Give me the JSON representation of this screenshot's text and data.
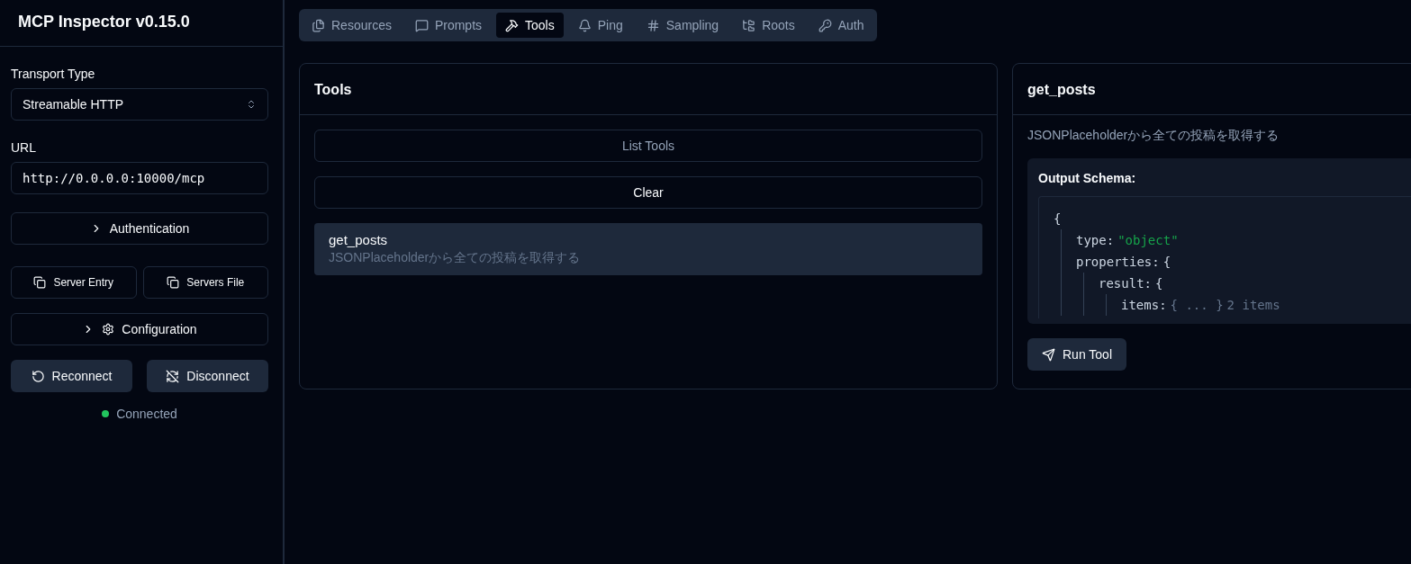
{
  "sidebar": {
    "title": "MCP Inspector v0.15.0",
    "transport": {
      "label": "Transport Type",
      "value": "Streamable HTTP"
    },
    "url": {
      "label": "URL",
      "value": "http://0.0.0.0:10000/mcp"
    },
    "authentication": {
      "label": "Authentication",
      "expanded": false
    },
    "server_entry": {
      "label": "Server Entry"
    },
    "servers_file": {
      "label": "Servers File"
    },
    "configuration": {
      "label": "Configuration",
      "expanded": false
    },
    "reconnect": {
      "label": "Reconnect"
    },
    "disconnect": {
      "label": "Disconnect"
    },
    "status": {
      "label": "Connected",
      "connected": true
    }
  },
  "tabs": [
    {
      "label": "Resources",
      "selected": false
    },
    {
      "label": "Prompts",
      "selected": false
    },
    {
      "label": "Tools",
      "selected": true
    },
    {
      "label": "Ping",
      "selected": false
    },
    {
      "label": "Sampling",
      "selected": false
    },
    {
      "label": "Roots",
      "selected": false
    },
    {
      "label": "Auth",
      "selected": false
    }
  ],
  "tools_panel": {
    "title": "Tools",
    "list_button": {
      "label": "List Tools",
      "disabled": true
    },
    "clear_button": {
      "label": "Clear",
      "disabled": false
    },
    "tools": [
      {
        "name": "get_posts",
        "description": "JSONPlaceholderから全ての投稿を取得する",
        "selected": true
      }
    ]
  },
  "detail_panel": {
    "title": "get_posts",
    "description": "JSONPlaceholderから全ての投稿を取得する",
    "schema_title": "Output Schema:",
    "schema": {
      "open": "{",
      "children": [
        {
          "key": "type:",
          "value": "\"object\"",
          "kind": "string"
        },
        {
          "key": "properties:",
          "value": "{",
          "kind": "open",
          "children": [
            {
              "key": "result:",
              "value": "{",
              "kind": "open",
              "children": [
                {
                  "key": "items:",
                  "value": "{ ... }",
                  "kind": "collapsed",
                  "note": "2 items"
                }
              ]
            }
          ]
        }
      ]
    },
    "run_button": {
      "label": "Run Tool"
    }
  }
}
